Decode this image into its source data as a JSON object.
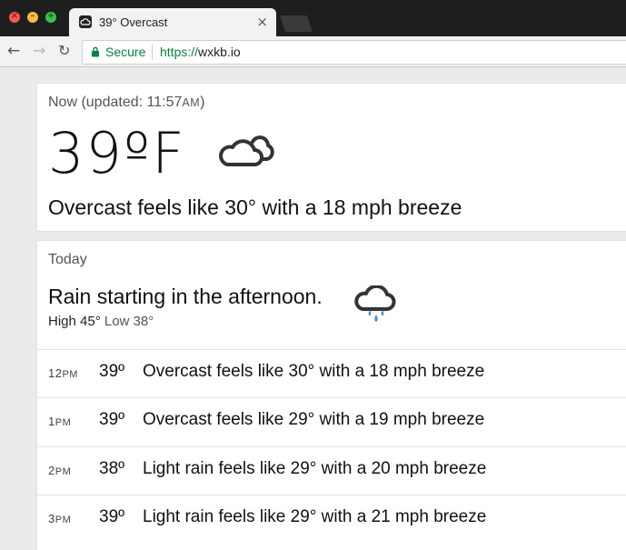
{
  "browser": {
    "tab_title": "39° Overcast",
    "tab_close": "×",
    "secure_label": "Secure",
    "url_scheme": "https://",
    "url_host": "wxkb.io"
  },
  "now": {
    "label": "Now (updated: 11:57",
    "label_ampm": "AM",
    "label_close": ")",
    "temperature": "39ºF",
    "summary": "Overcast feels like 30° with a 18 mph breeze",
    "icon": "cloud-icon"
  },
  "today": {
    "label": "Today",
    "headline": "Rain starting in the afternoon.",
    "high": "High 45°",
    "low": "Low 38°",
    "icon": "rain-icon",
    "hours": [
      {
        "hour": "12PM",
        "temp": "39º",
        "desc": "Overcast feels like 30° with a 18 mph breeze"
      },
      {
        "hour": "1PM",
        "temp": "39º",
        "desc": "Overcast feels like 29° with a 19 mph breeze"
      },
      {
        "hour": "2PM",
        "temp": "38º",
        "desc": "Light rain feels like 29° with a 20 mph breeze"
      },
      {
        "hour": "3PM",
        "temp": "39º",
        "desc": "Light rain feels like 29° with a 21 mph breeze"
      }
    ]
  },
  "colors": {
    "secure_green": "#0b8043",
    "rain_drop": "#5b8ec7"
  }
}
